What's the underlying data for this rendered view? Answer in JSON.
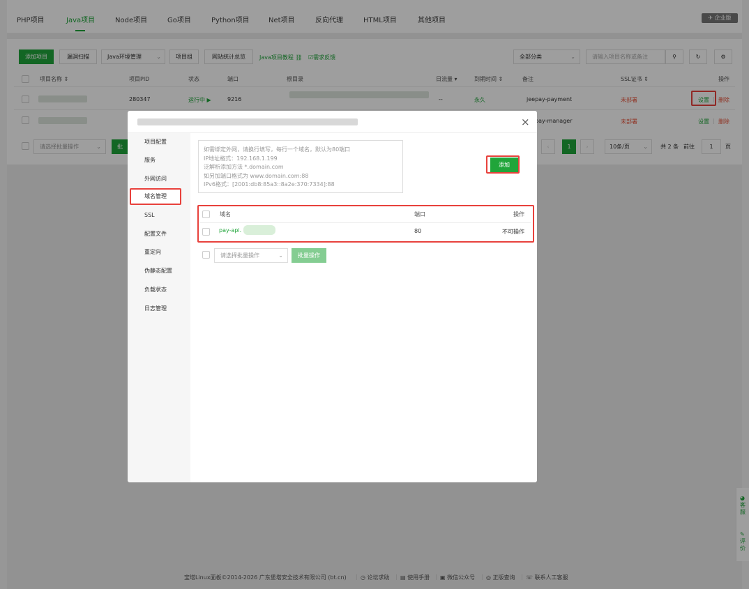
{
  "tabs": [
    "PHP项目",
    "Java项目",
    "Node项目",
    "Go项目",
    "Python项目",
    "Net项目",
    "反向代理",
    "HTML项目",
    "其他项目"
  ],
  "enterprise_badge": "企业版",
  "toolbar": {
    "add_project": "添加项目",
    "vuln_scan": "漏洞扫描",
    "java_env": "Java环境管理",
    "project_group": "项目组",
    "site_stats": "网站统计总览",
    "java_tutorial": "Java项目教程",
    "feedback": "需求反馈",
    "category": "全部分类",
    "search_placeholder": "请输入项目名称或备注"
  },
  "table": {
    "headers": {
      "name": "项目名称",
      "pid": "项目PID",
      "status": "状态",
      "port": "端口",
      "root": "根目录",
      "traffic": "日流量",
      "expire": "到期时间",
      "remark": "备注",
      "ssl": "SSL证书",
      "ops": "操作"
    },
    "rows": [
      {
        "pid": "280347",
        "status": "运行中",
        "port": "9216",
        "traffic": "--",
        "expire": "永久",
        "remark": "jeepay-payment",
        "ssl": "未部署",
        "set": "设置",
        "del": "删除"
      },
      {
        "remark": "jeepay-manager",
        "ssl": "未部署",
        "set": "设置",
        "del": "删除"
      }
    ],
    "batch_select": "请选择批量操作",
    "batch_btn": "批",
    "pagination": {
      "current": "1",
      "per_page": "10条/页",
      "total": "共 2 条",
      "goto": "前往",
      "page_input": "1",
      "page_suffix": "页"
    }
  },
  "modal": {
    "close": "×",
    "sidebar": [
      "项目配置",
      "服务",
      "外网访问",
      "域名管理",
      "SSL",
      "配置文件",
      "重定向",
      "伪静态配置",
      "负载状态",
      "日志管理"
    ],
    "textarea_lines": [
      "如需绑定外网，请换行填写，每行一个域名，默认为80端口",
      "IP地址格式：192.168.1.199",
      "泛解析添加方法 *.domain.com",
      "如另加端口格式为 www.domain.com:88",
      "IPv6格式：[2001:db8:85a3::8a2e:370:7334]:88"
    ],
    "add_btn": "添加",
    "domain_table": {
      "headers": {
        "domain": "域名",
        "port": "端口",
        "ops": "操作"
      },
      "rows": [
        {
          "domain": "pay-api.",
          "port": "80",
          "ops": "不可操作"
        }
      ]
    },
    "batch_select": "请选择批量操作",
    "batch_btn": "批量操作"
  },
  "footer": {
    "copyright": "宝塔Linux面板©2014-2026 广东堡塔安全技术有限公司 (bt.cn)",
    "links": [
      "论坛求助",
      "使用手册",
      "微信公众号",
      "正版查询",
      "联系人工客服"
    ]
  },
  "float": {
    "service": "客服",
    "rate": "评价"
  },
  "colors": {
    "accent": "#20a53a",
    "danger": "#e8553c",
    "highlight": "#e8413c"
  }
}
